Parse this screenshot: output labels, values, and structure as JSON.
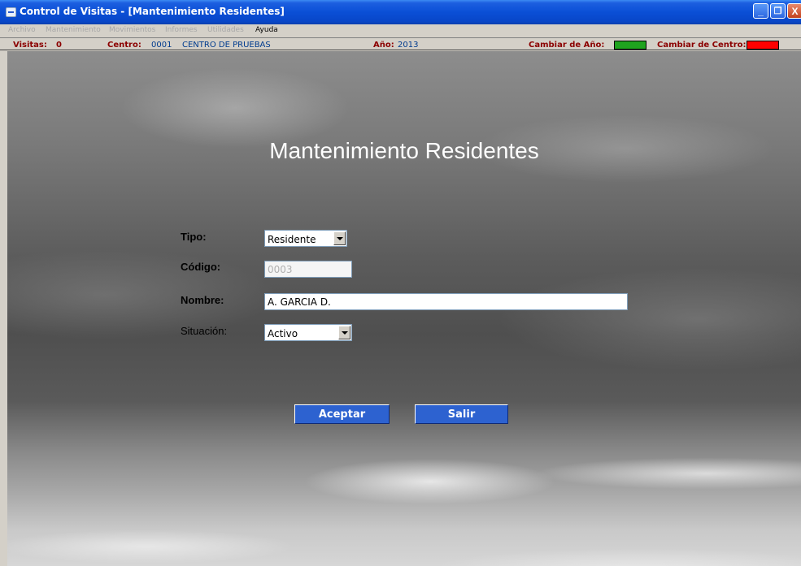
{
  "window": {
    "title": "Control de Visitas - [Mantenimiento Residentes]",
    "controls": {
      "minimize": "_",
      "maximize": "❐",
      "close": "X"
    }
  },
  "menu": [
    {
      "label": "Archivo",
      "enabled": false
    },
    {
      "label": "Mantenimiento",
      "enabled": false
    },
    {
      "label": "Movimientos",
      "enabled": false
    },
    {
      "label": "Informes",
      "enabled": false
    },
    {
      "label": "Utilidades",
      "enabled": false
    },
    {
      "label": "Ayuda",
      "enabled": true
    }
  ],
  "status": {
    "visitas_label": "Visitas:",
    "visitas_value": "0",
    "centro_label": "Centro:",
    "centro_code": "0001",
    "centro_name": "CENTRO DE PRUEBAS",
    "anio_label": "Año:",
    "anio_value": "2013",
    "cambiar_anio_label": "Cambiar de Año:",
    "cambiar_anio_color": "#1fa31f",
    "cambiar_centro_label": "Cambiar de Centro:",
    "cambiar_centro_color": "#ff0000"
  },
  "form": {
    "heading": "Mantenimiento Residentes",
    "tipo": {
      "label": "Tipo:",
      "value": "Residente"
    },
    "codigo": {
      "label": "Código:",
      "value": "0003"
    },
    "nombre": {
      "label": "Nombre:",
      "value": "A. GARCIA D."
    },
    "situacion": {
      "label": "Situación:",
      "value": "Activo"
    }
  },
  "buttons": {
    "accept": "Aceptar",
    "exit": "Salir"
  }
}
